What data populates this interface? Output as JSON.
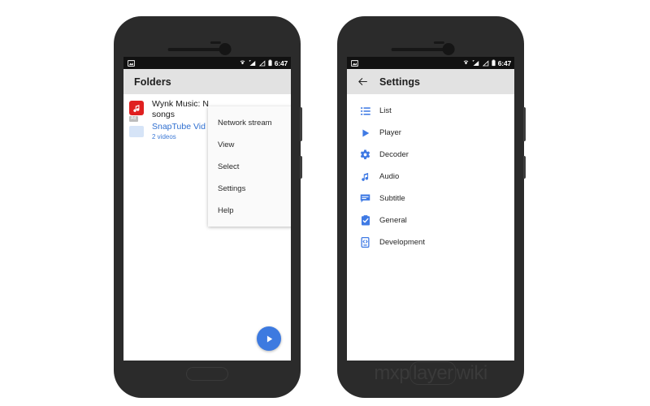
{
  "scene": {
    "background_color": "#ffffff",
    "accent_blue": "#3d7ae0",
    "icon_blue": "#3f7ae4",
    "ad_red": "#e02020",
    "toolbar_gray": "#e2e2e2",
    "statusbar_black": "#111111",
    "chassis_color": "#2b2b2b"
  },
  "status_bar": {
    "clock": "6:47",
    "left_icons": [
      "screenshot-icon"
    ],
    "right_icons": [
      "cast-icon",
      "signal-bars-icon",
      "signal-triangle-icon",
      "battery-icon"
    ]
  },
  "left_phone": {
    "toolbar": {
      "title": "Folders"
    },
    "ad_row": {
      "badge": "Ad",
      "icon": "wynk-music-icon",
      "title_line1": "Wynk Music: N",
      "title_line2": "songs"
    },
    "folder_row": {
      "icon": "folder-icon",
      "title": "SnapTube Vid",
      "subtitle": "2 videos"
    },
    "menu": {
      "items": [
        {
          "label": "Network stream",
          "has_submenu": false
        },
        {
          "label": "View",
          "has_submenu": true
        },
        {
          "label": "Select",
          "has_submenu": false
        },
        {
          "label": "Settings",
          "has_submenu": false
        },
        {
          "label": "Help",
          "has_submenu": true
        }
      ]
    },
    "fab": {
      "icon": "play-icon"
    },
    "hardware": {
      "home_button": "home-button"
    }
  },
  "right_phone": {
    "toolbar": {
      "back_icon": "back-arrow-icon",
      "title": "Settings"
    },
    "settings_items": [
      {
        "label": "List",
        "icon": "list-icon"
      },
      {
        "label": "Player",
        "icon": "play-icon"
      },
      {
        "label": "Decoder",
        "icon": "gear-icon"
      },
      {
        "label": "Audio",
        "icon": "music-note-icon"
      },
      {
        "label": "Subtitle",
        "icon": "speech-bubble-icon"
      },
      {
        "label": "General",
        "icon": "clipboard-check-icon"
      },
      {
        "label": "Development",
        "icon": "developer-phone-icon"
      }
    ],
    "watermark": {
      "prefix": "mxp",
      "circled": "layer",
      "suffix": "wiki"
    }
  }
}
